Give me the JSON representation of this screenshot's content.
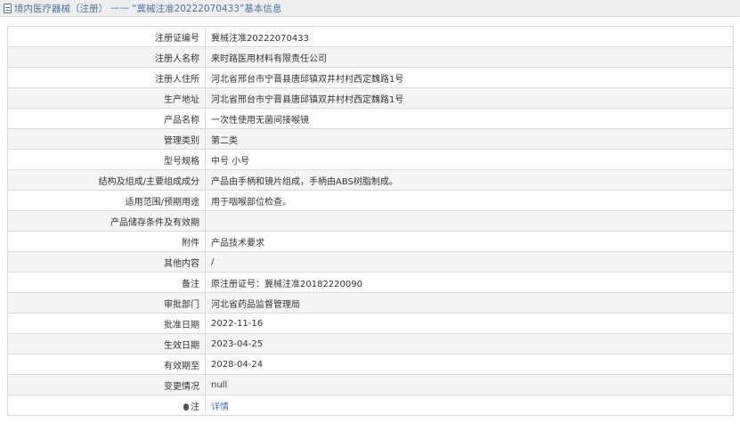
{
  "header": {
    "category": "境内医疗器械（注册）",
    "separator": "——",
    "record_title": "“冀械注准20222070433”基本信息"
  },
  "rows": [
    {
      "label": "注册证编号",
      "value": "冀械注准20222070433"
    },
    {
      "label": "注册人名称",
      "value": "来时路医用材料有限责任公司"
    },
    {
      "label": "注册人住所",
      "value": "河北省邢台市宁晋县唐邱镇双井村村西定魏路1号"
    },
    {
      "label": "生产地址",
      "value": "河北省邢台市宁晋县唐邱镇双井村村西定魏路1号"
    },
    {
      "label": "产品名称",
      "value": "一次性使用无菌间接喉镜"
    },
    {
      "label": "管理类别",
      "value": "第二类"
    },
    {
      "label": "型号规格",
      "value": "中号 小号"
    },
    {
      "label": "结构及组成/主要组成成分",
      "value": "产品由手柄和镜片组成，手柄由ABS树脂制成。"
    },
    {
      "label": "适用范围/预期用途",
      "value": "用于咽喉部位检查。"
    },
    {
      "label": "产品储存条件及有效期",
      "value": ""
    },
    {
      "label": "附件",
      "value": "产品技术要求"
    },
    {
      "label": "其他内容",
      "value": "/"
    },
    {
      "label": "备注",
      "value": "原注册证号：冀械注准20182220090"
    },
    {
      "label": "审批部门",
      "value": "河北省药品监督管理局"
    },
    {
      "label": "批准日期",
      "value": "2022-11-16"
    },
    {
      "label": "生效日期",
      "value": "2023-04-25"
    },
    {
      "label": "有效期至",
      "value": "2028-04-24"
    },
    {
      "label": "变更情况",
      "value": "null"
    }
  ],
  "note_row": {
    "label": "注",
    "link": "详情",
    "icon": "note-icon"
  },
  "colors": {
    "link": "#4a74a5",
    "header_bg": "#eeeeee",
    "border": "#dadada"
  }
}
